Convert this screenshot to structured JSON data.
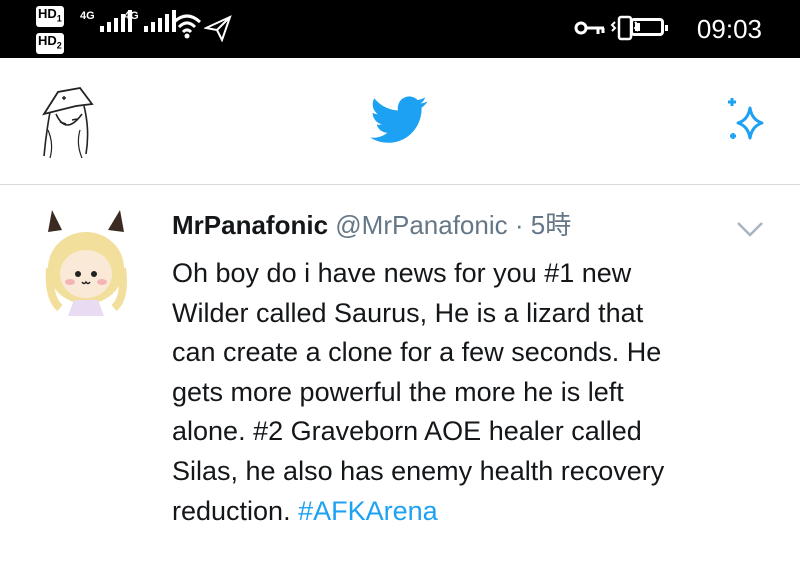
{
  "status_bar": {
    "hd1": "HD",
    "hd1_sub": "1",
    "hd2": "HD",
    "hd2_sub": "2",
    "net1": "4G",
    "net2": "4G",
    "time": "09:03",
    "battery_level": 0.2,
    "icons": [
      "signal-icon",
      "wifi-icon",
      "airplane-send-icon",
      "key-icon",
      "vibrate-icon",
      "battery-icon"
    ]
  },
  "header": {
    "profile_icon": "profile-avatar",
    "logo_icon": "twitter-bird-icon",
    "compose_icon": "sparkle-icon",
    "brand_color": "#1DA1F2"
  },
  "tweet": {
    "display_name": "MrPanafonic",
    "handle": "@MrPanafonic",
    "separator": "·",
    "age": "5時",
    "lines": [
      "Oh boy do i have news for you #1 new",
      "Wilder called Saurus, He is a lizard that",
      "can create a clone for a few seconds. He",
      "gets more powerful the more he is left",
      "alone. #2 Graveborn AOE healer called",
      "Silas, he also has enemy health recovery",
      "reduction. "
    ],
    "hashtag": "#AFKArena"
  }
}
